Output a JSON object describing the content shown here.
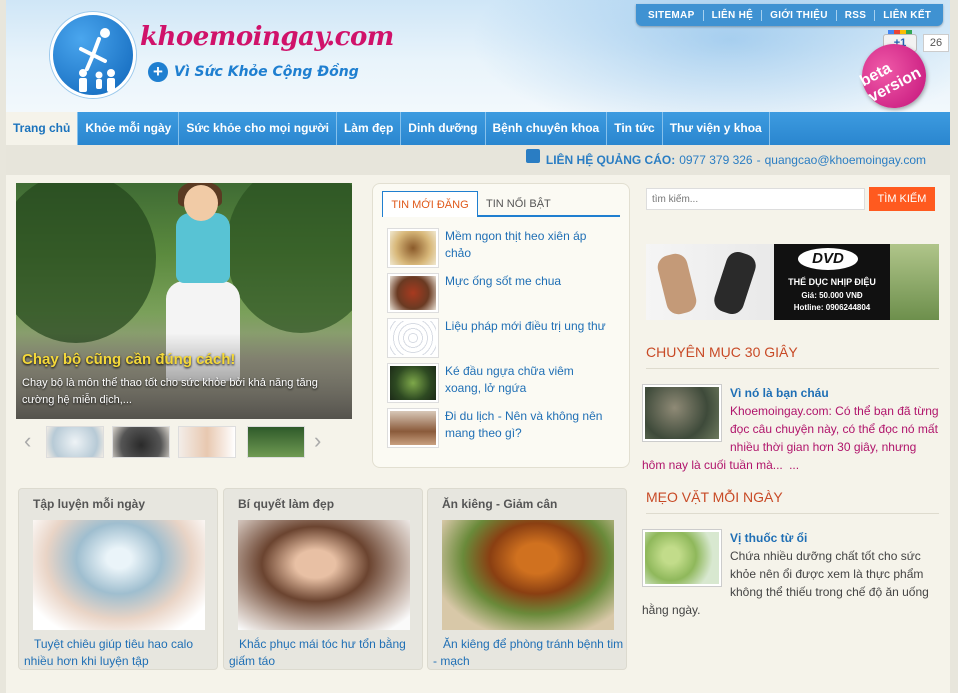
{
  "header": {
    "logo_text": "khoemoingay.com",
    "slogan": "Vì Sức Khỏe Cộng Đồng",
    "top_links": [
      "SITEMAP",
      "LIÊN HỆ",
      "GIỚI THIỆU",
      "RSS",
      "LIÊN KẾT"
    ],
    "gplus_label": "+1",
    "gplus_count": "26",
    "beta_badge": "beta version"
  },
  "nav": {
    "items": [
      "Trang chủ",
      "Khỏe mỗi ngày",
      "Sức khỏe cho mọi người",
      "Làm đẹp",
      "Dinh dưỡng",
      "Bệnh chuyên khoa",
      "Tin tức",
      "Thư viện y khoa"
    ],
    "active_index": 0
  },
  "contact": {
    "label": "LIÊN HỆ QUẢNG CÁO:",
    "phone": "0977 379 326",
    "sep": "-",
    "email": "quangcao@khoemoingay.com"
  },
  "slider": {
    "title": "Chạy bộ cũng cần đúng cách!",
    "text": "Chạy bộ là môn thể thao tốt cho sức khỏe bởi khả năng tăng cường hệ miễn dịch,...",
    "prev_arrow": "‹",
    "next_arrow": "›"
  },
  "tabs": {
    "items": [
      "TIN MỚI ĐĂNG",
      "TIN NỔI BẬT"
    ],
    "active_index": 0,
    "news": [
      {
        "title": "Mềm ngon thịt heo xiên áp chảo"
      },
      {
        "title": "Mực ống sốt me chua"
      },
      {
        "title": "Liệu pháp mới điều trị ung thư"
      },
      {
        "title": "Ké đầu ngựa chữa viêm xoang, lở ngứa"
      },
      {
        "title": "Đi du lịch - Nên và không nên mang theo gì?"
      }
    ]
  },
  "categories": [
    {
      "title": "Tập luyện mỗi ngày",
      "caption": "Tuyệt chiêu giúp tiêu hao calo nhiều hơn khi luyện tập"
    },
    {
      "title": "Bí quyết làm đẹp",
      "caption": "Khắc phục mái tóc hư tổn bằng giấm táo"
    },
    {
      "title": "Ăn kiêng - Giảm cân",
      "caption": "Ăn kiêng để phòng tránh bệnh tim - mạch"
    }
  ],
  "search": {
    "placeholder": "tìm kiếm...",
    "button": "TÌM KIẾM"
  },
  "banner": {
    "dvd": "DVD",
    "line1": "THỂ DỤC NHỊP ĐIỆU",
    "price": "Giá: 50.000 VNĐ",
    "hotline": "Hotline: 0906244804"
  },
  "sections": {
    "chuyen_muc": {
      "title": "CHUYÊN MỤC 30 GIÂY",
      "head": "Vì nó là bạn cháu",
      "body": "Khoemoingay.com: Có thể bạn đã từng đọc câu chuyện này, có thể đọc nó mất nhiều thời gian hơn 30 giây, nhưng hôm nay là cuối tuần mà...",
      "more": "..."
    },
    "meo_vat": {
      "title": "MẸO VẶT MỖI NGÀY",
      "head": "Vị thuốc từ ổi",
      "body": "Chứa nhiều dưỡng chất tốt cho sức khỏe nên ổi được xem là thực phẩm không thể thiếu trong chế độ ăn uống hằng ngày."
    }
  },
  "colors": {
    "nav_blue": "#2a86cf",
    "link_blue": "#1f6fb5",
    "brand_pink": "#d0126a",
    "section_orange": "#c84a26",
    "search_button": "#ff5a1f"
  }
}
